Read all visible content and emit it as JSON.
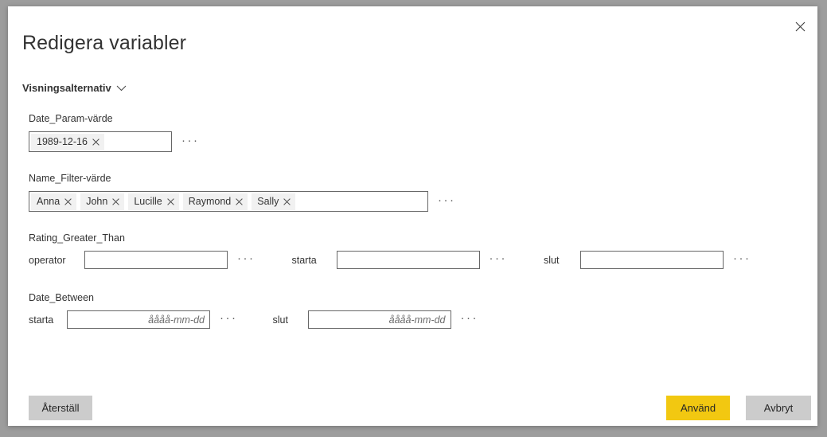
{
  "dialog": {
    "title": "Redigera variabler",
    "close_icon": "close-icon"
  },
  "display_options": {
    "label": "Visningsalternativ",
    "chevron_icon": "chevron-down-icon"
  },
  "ellipsis_label": "···",
  "fields": {
    "date_param": {
      "label": "Date_Param-värde",
      "tokens": [
        "1989-12-16"
      ]
    },
    "name_filter": {
      "label": "Name_Filter-värde",
      "tokens": [
        "Anna",
        "John",
        "Lucille",
        "Raymond",
        "Sally"
      ]
    },
    "rating_greater_than": {
      "label": "Rating_Greater_Than",
      "operator_label": "operator",
      "operator_value": "",
      "start_label": "starta",
      "start_value": "",
      "end_label": "slut",
      "end_value": ""
    },
    "date_between": {
      "label": "Date_Between",
      "start_label": "starta",
      "start_value": "",
      "start_placeholder": "åååå-mm-dd",
      "end_label": "slut",
      "end_value": "",
      "end_placeholder": "åååå-mm-dd"
    }
  },
  "footer": {
    "reset_label": "Återställ",
    "apply_label": "Använd",
    "cancel_label": "Avbryt"
  },
  "colors": {
    "accent_yellow": "#f2c811",
    "button_gray": "#cccccc",
    "backdrop": "#9d9d9d",
    "token_bg": "#f1f1f1",
    "border": "#666666"
  }
}
